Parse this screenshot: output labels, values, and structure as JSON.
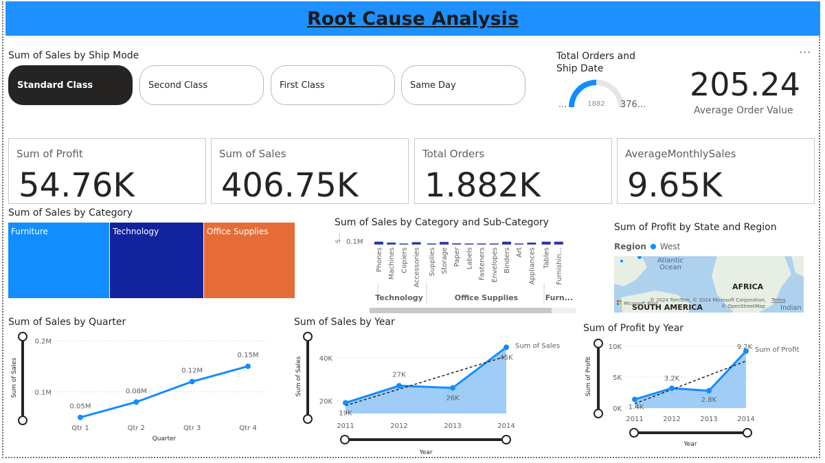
{
  "report": {
    "title": "Root Cause Analysis "
  },
  "more_options": "...",
  "ship_mode": {
    "title": "Sum of Sales by Ship Mode",
    "options": [
      "Standard Class",
      "Second Class",
      "First Class",
      "Same Day"
    ],
    "selected": "Standard Class"
  },
  "gauge": {
    "title_line1": "Total Orders and",
    "title_line2": "Ship Date",
    "min_label": "...",
    "value_label": "1882",
    "max_label": "376...",
    "fill_fraction": 0.5
  },
  "aov": {
    "value": "205.24",
    "label": "Average Order Value"
  },
  "kpis": [
    {
      "label": "Sum of Profit",
      "value": "54.76K"
    },
    {
      "label": "Sum of Sales",
      "value": "406.75K"
    },
    {
      "label": "Total Orders",
      "value": "1.882K"
    },
    {
      "label": "AverageMonthlySales",
      "value": "9.65K"
    }
  ],
  "category_treemap": {
    "title": "Sum of Sales by Category",
    "cells": [
      {
        "label": "Furniture",
        "color": "#118dff"
      },
      {
        "label": "Technology",
        "color": "#12239e"
      },
      {
        "label": "Office Supplies",
        "color": "#e66c37"
      }
    ]
  },
  "subcategory": {
    "title": "Sum of Sales by Category and Sub-Category",
    "y_axis_label": "S...",
    "y_tick": "0.1M",
    "subcategories": [
      "Phones",
      "Machines",
      "Copiers",
      "Accessories",
      "Supplies",
      "Storage",
      "Paper",
      "Labels",
      "Fasteners",
      "Envelopes",
      "Binders",
      "Art",
      "Appliances",
      "Tables",
      "Furnishin..."
    ],
    "groups": [
      "Technology",
      "Office Supplies",
      "Furn..."
    ]
  },
  "map": {
    "title": "Sum of Profit by State and Region",
    "legend_title": "Region",
    "legend_item": "West",
    "labels": {
      "atlantic": "Atlantic",
      "ocean": "Ocean",
      "africa": "AFRICA",
      "south_america": "SOUTH AMERICA",
      "indian": "Indian"
    },
    "copyright": "© 2024 TomTom, © 2024 Microsoft Corporation,",
    "osm": "© OpenStreetMap",
    "terms": "Terms",
    "brand": "Microsoft Bing"
  },
  "quarter_chart": {
    "title": "Sum of Sales by Quarter",
    "ylabel": "Sum of Sales",
    "xlabel": "Quarter",
    "y_ticks": [
      "0.2M",
      "0.1M"
    ]
  },
  "year_sales_chart": {
    "title": "Sum of Sales by Year",
    "ylabel": "Sum of Sales",
    "xlabel": "Year",
    "series_name": "Sum of Sales",
    "y_ticks": [
      "40K",
      "20K"
    ]
  },
  "year_profit_chart": {
    "title": "Sum of Profit by Year",
    "ylabel": "Sum of Profit",
    "xlabel": "Year",
    "series_name": "Sum of Profit",
    "y_ticks": [
      "10K",
      "5K",
      "0K"
    ]
  },
  "chart_data": [
    {
      "type": "line",
      "title": "Sum of Sales by Quarter",
      "xlabel": "Quarter",
      "ylabel": "Sum of Sales",
      "categories": [
        "Qtr 1",
        "Qtr 2",
        "Qtr 3",
        "Qtr 4"
      ],
      "values": [
        0.05,
        0.08,
        0.12,
        0.15
      ],
      "data_labels": [
        "0.05M",
        "0.08M",
        "0.12M",
        "0.15M"
      ],
      "ylim": [
        0.04,
        0.2
      ],
      "color": "#118dff"
    },
    {
      "type": "area",
      "title": "Sum of Sales by Year",
      "xlabel": "Year",
      "ylabel": "Sum of Sales",
      "categories": [
        "2011",
        "2012",
        "2013",
        "2014"
      ],
      "series": [
        {
          "name": "Sum of Sales",
          "values": [
            19,
            27,
            26,
            45
          ]
        }
      ],
      "data_labels": [
        "19K",
        "27K",
        "26K",
        "45K"
      ],
      "trend_line": true,
      "ylim": [
        14,
        50
      ],
      "color": "#118dff"
    },
    {
      "type": "area",
      "title": "Sum of Profit by Year",
      "xlabel": "Year",
      "ylabel": "Sum of Profit",
      "categories": [
        "2011",
        "2012",
        "2013",
        "2014"
      ],
      "series": [
        {
          "name": "Sum of Profit",
          "values": [
            1.4,
            3.2,
            2.8,
            9.2
          ]
        }
      ],
      "data_labels": [
        "1.4K",
        "3.2K",
        "2.8K",
        "9.2K"
      ],
      "trend_line": true,
      "ylim": [
        0,
        10
      ],
      "color": "#118dff"
    },
    {
      "type": "bar",
      "title": "Sum of Sales by Category and Sub-Category",
      "categories": [
        "Phones",
        "Machines",
        "Copiers",
        "Accessories",
        "Supplies",
        "Storage",
        "Paper",
        "Labels",
        "Fasteners",
        "Envelopes",
        "Binders",
        "Art",
        "Appliances",
        "Tables",
        "Furnishin..."
      ],
      "values": [
        0.03,
        0.02,
        0.005,
        0.025,
        0.003,
        0.027,
        0.012,
        0.005,
        0.001,
        0.005,
        0.03,
        0.005,
        0.02,
        0.03,
        0.03
      ],
      "ylim": [
        0,
        0.1
      ]
    }
  ]
}
